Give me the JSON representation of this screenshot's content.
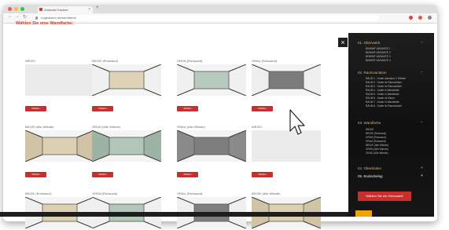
{
  "browser": {
    "tab_title": "Gottwald Kastner",
    "url": "hugkastner.de/wandfarbe",
    "close_tab": "×",
    "new_tab": "+",
    "back": "←",
    "forward": "→",
    "reload": "↻"
  },
  "page": {
    "heading": "Wählen Sie eine Wandfarbe:",
    "button_label": "Wählen",
    "close_label": "×",
    "cards": [
      {
        "label": "WEISS",
        "wall": "#ebebeb",
        "side": "#f2f2f2"
      },
      {
        "label": "BEIGE (Rohwand)",
        "wall": "#dfd2b6",
        "side": "#f0f0f0"
      },
      {
        "label": "GRÜN (Rohwand)",
        "wall": "#b7c8bd",
        "side": "#f0f0f0"
      },
      {
        "label": "GRAU (Rohwand)",
        "wall": "#7b7b7b",
        "side": "#eeeeee"
      },
      {
        "label": "BEIGE (Alle Wände)",
        "wall": "#ddd0b2",
        "side": "#d0c3a6"
      },
      {
        "label": "GRÜN (Alle Wände)",
        "wall": "#b3c6ba",
        "side": "#9db3a6"
      },
      {
        "label": "GRAU (Alle Wände)",
        "wall": "#7e7e7e",
        "side": "#8a8a8a"
      },
      {
        "label": "WEISS",
        "wall": "#ececec",
        "side": "#f2f2f2"
      },
      {
        "label": "BEIGE (Rohwand)",
        "wall": "#ddd0b2",
        "side": "#efefef"
      },
      {
        "label": "GRÜN (Rohwand)",
        "wall": "#b3c6ba",
        "side": "#efefef"
      },
      {
        "label": "GRAU (Rohwand)",
        "wall": "#7e7e7e",
        "side": "#efefef"
      },
      {
        "label": "BEIGE (Alle Wände)",
        "wall": "#ddd0b2",
        "side": "#d0c3a6"
      }
    ]
  },
  "sidebar": {
    "sections": [
      {
        "title": "01. Oberwaldt",
        "items": [
          "BHMW® VARIANTE 1",
          "BHMW® VARIANTE 2",
          "BHMW® VARIANTE 3",
          "BHMW® VARIANTE 4"
        ]
      },
      {
        "title": "02. Raumvariation",
        "items": [
          "RAUM 1 - Kante standard, 2 Wände",
          "RAUM 2 - Kante im Raumwinkel",
          "RAUM 3 - Kante im Raumwinkel",
          "RAUM 4 - Kante in Wandmitte",
          "RAUM 5 - Kante in Wandecke",
          "RAUM 6 - Kante im Raum",
          "RAUM 7 - Kante in Wandmitte",
          "RAUM 8 - Kante im Raumwinkel"
        ]
      },
      {
        "title": "03. Wandfarbe",
        "items": [
          "WEISS",
          "BEIGE (Rohwand)",
          "GRÜN (Rohwand)",
          "GRAU (Rohwand)",
          "BEIGE (Alle Wände)",
          "GRÜN (Alle Wände)",
          "GRAU (Alle Wände)"
        ]
      },
      {
        "title": "04. Oberböden",
        "items": []
      },
      {
        "title": "05. Bodenbelag",
        "items": []
      }
    ],
    "button": "Wählen Sie ein Oberwaldt!",
    "plus": "+"
  },
  "colors": {
    "accent": "#c9302c",
    "heading": "#d2432f",
    "sidebar_title": "#e0b05a",
    "sidebar_bg": "#141414",
    "orange_tab": "#f0a400"
  }
}
